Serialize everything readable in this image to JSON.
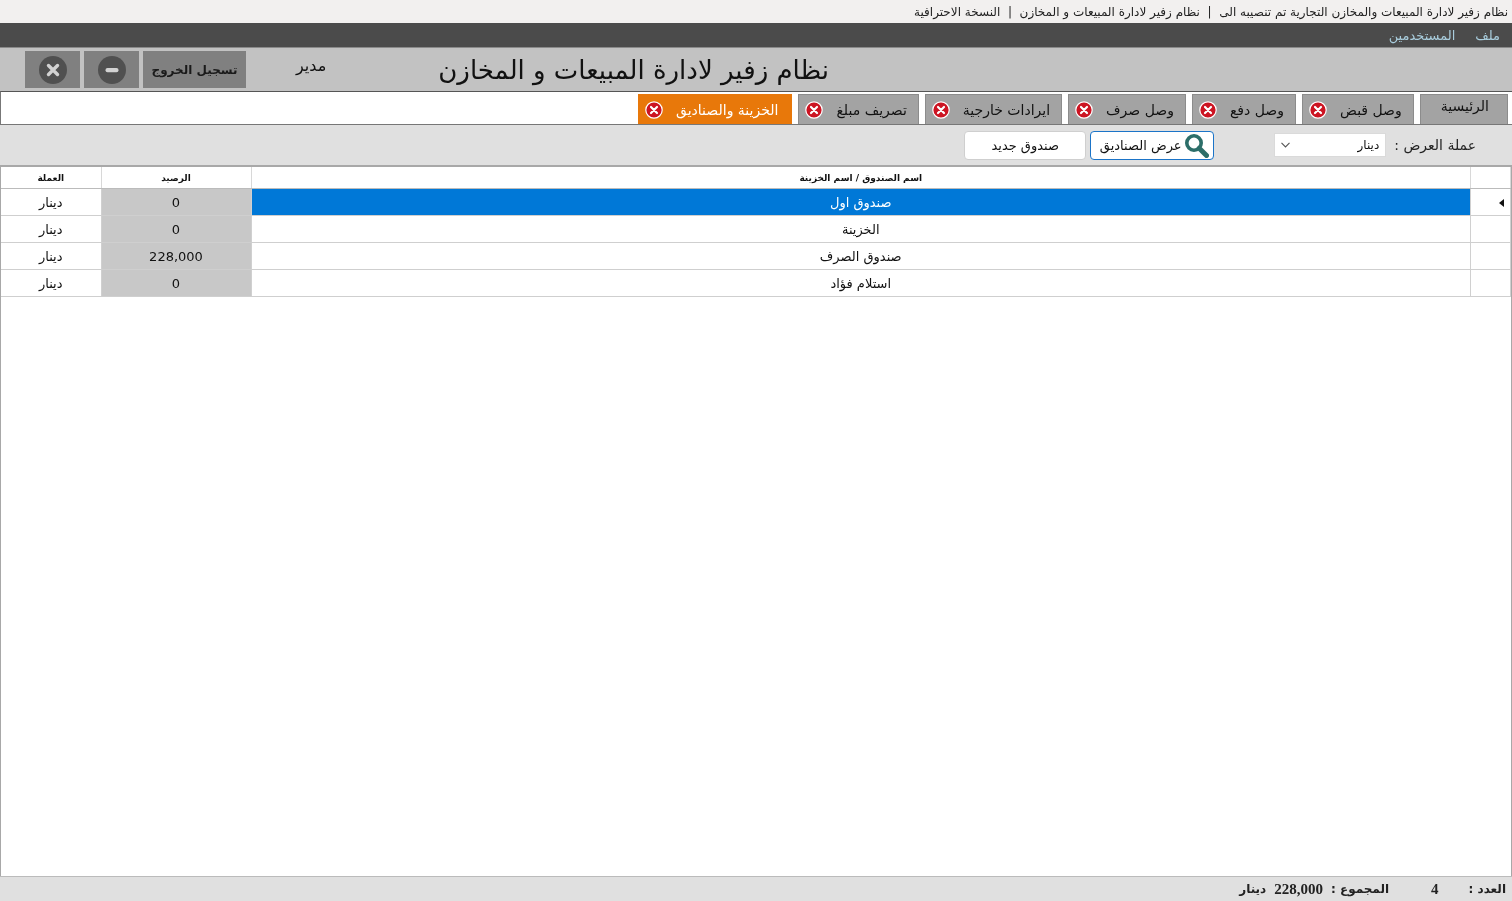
{
  "window": {
    "title": "نظام زفير لادارة المبيعات والمخازن التجارية تم تنصيبه الى  |  نظام زفير لادارة المبيعات و المخازن  |  النسخة الاحترافية"
  },
  "menu": [
    {
      "label": "ملف"
    },
    {
      "label": "المستخدمين"
    }
  ],
  "header": {
    "title": "نظام زفير لادارة المبيعات و المخازن",
    "user_role": "مدير",
    "logout_button": "تسجيل الخروج"
  },
  "tabs": [
    {
      "label": "الرئيسية",
      "selected": false,
      "closable": false
    },
    {
      "label": "وصل قبض",
      "selected": false,
      "closable": true
    },
    {
      "label": "وصل دفع",
      "selected": false,
      "closable": true
    },
    {
      "label": "وصل صرف",
      "selected": false,
      "closable": true
    },
    {
      "label": "ايرادات خارجية",
      "selected": false,
      "closable": true
    },
    {
      "label": "تصريف مبلغ",
      "selected": false,
      "closable": true
    },
    {
      "label": "الخزينة والصناديق",
      "selected": true,
      "closable": true
    }
  ],
  "toolbar": {
    "currency_label": "عملة العرض :",
    "currency_select": {
      "value": "دينار"
    },
    "buttons": [
      {
        "label": "عرض الصناديق",
        "kind": "search",
        "focused": true
      },
      {
        "label": "صندوق جديد",
        "kind": "plain",
        "focused": false
      }
    ]
  },
  "table": {
    "columns": [
      "اسم الصندوق / اسم الخزينة",
      "الرصيد",
      "العملة"
    ],
    "rows": [
      {
        "name": "صندوق اول",
        "balance": "0",
        "currency": "دينار",
        "selected": true
      },
      {
        "name": "الخزينة",
        "balance": "0",
        "currency": "دينار",
        "selected": false
      },
      {
        "name": "صندوق الصرف",
        "balance": "228,000",
        "currency": "دينار",
        "selected": false
      },
      {
        "name": "استلام فؤاد",
        "balance": "0",
        "currency": "دينار",
        "selected": false
      }
    ]
  },
  "status_bar": {
    "count_label": "العدد :",
    "count": "4",
    "total_label": "المجموع :",
    "total": "228,000",
    "currency": "دينار"
  }
}
